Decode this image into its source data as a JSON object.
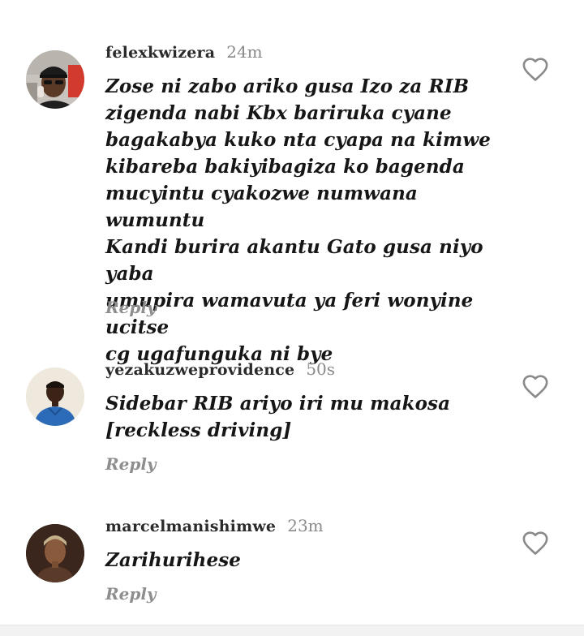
{
  "top_fragment": "~",
  "comments": [
    {
      "username": "felexkwizera",
      "time": "24m",
      "text": "Zose ni zabo ariko gusa Izo za RIB\nzigenda nabi Kbx  bariruka cyane\nbagakabya kuko nta cyapa na kimwe\nkibareba bakiyibagiza ko bagenda\nmucyintu cyakozwe numwana wumuntu\nKandi burira  akantu Gato gusa niyo yaba\numupira wamavuta ya feri wonyine ucitse\ncg ugafunguka  ni bye",
      "reply_label": "Reply",
      "like_icon": "heart-outline-icon"
    },
    {
      "username": "yezakuzweprovidence",
      "time": "50s",
      "text": "Sidebar RIB ariyo iri mu makosa\n[reckless driving]",
      "reply_label": "Reply",
      "like_icon": "heart-outline-icon"
    },
    {
      "username": "marcelmanishimwe",
      "time": "23m",
      "text": "Zarihurihese",
      "reply_label": "Reply",
      "like_icon": "heart-outline-icon"
    }
  ],
  "colors": {
    "text": "#161616",
    "muted": "#8e8e8e",
    "icon": "#8a8a8a",
    "background": "#ffffff"
  }
}
